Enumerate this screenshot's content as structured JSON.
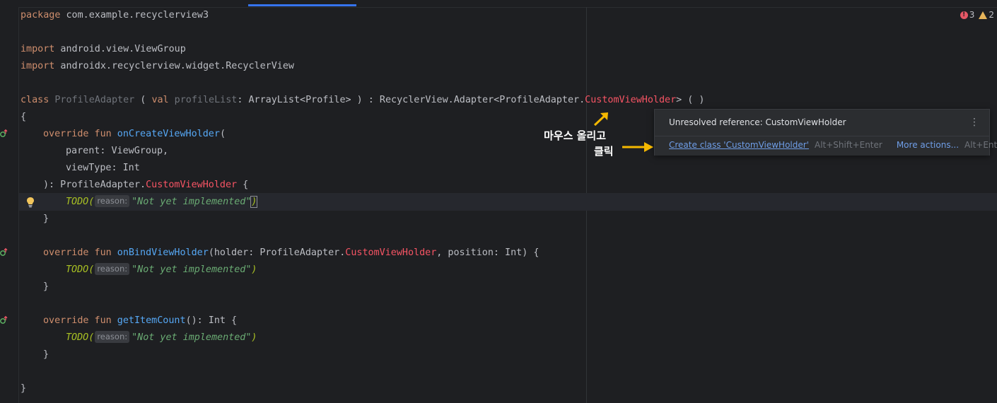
{
  "editor": {
    "line1": {
      "kw": "package",
      "rest": " com.example.recyclerview3"
    },
    "line2": {
      "kw": "import",
      "rest": " android.view.ViewGroup"
    },
    "line3": {
      "kw": "import",
      "rest": " androidx.recyclerview.widget.RecyclerView"
    },
    "line4": {
      "kw1": "class",
      "cls": " ProfileAdapter",
      "p1": " ( ",
      "kw2": "val",
      "param": " profileList",
      "p2": ": ArrayList<Profile> ) : RecyclerView.Adapter<ProfileAdapter.",
      "err": "CustomViewHolder",
      "p3": "> ( )"
    },
    "line5": "{",
    "line6": {
      "kw": "override fun",
      "fn": " onCreateViewHolder",
      "rest": "("
    },
    "line7": "parent: ViewGroup,",
    "line8": "viewType: Int",
    "line9": {
      "a": "): ProfileAdapter.",
      "err": "CustomViewHolder",
      "b": " {"
    },
    "line10": {
      "todo": "TODO(",
      "hint": "reason:",
      "str": "\"Not yet implemented\"",
      "close": ")"
    },
    "line11": "}",
    "line12": {
      "kw": "override fun",
      "fn": " onBindViewHolder",
      "a": "(holder: ProfileAdapter.",
      "err": "CustomViewHolder",
      "b": ", position: Int) {"
    },
    "line13": {
      "todo": "TODO(",
      "hint": "reason:",
      "str": "\"Not yet implemented\"",
      "close": ")"
    },
    "line14": "}",
    "line15": {
      "kw": "override fun",
      "fn": " getItemCount",
      "rest": "(): Int {"
    },
    "line16": {
      "todo": "TODO(",
      "hint": "reason:",
      "str": "\"Not yet implemented\"",
      "close": ")"
    },
    "line17": "}",
    "line18": "}"
  },
  "indicators": {
    "errors": "3",
    "warnings": "2"
  },
  "popup": {
    "title": "Unresolved reference: CustomViewHolder",
    "menu": "⋮",
    "action": "Create class 'CustomViewHolder'",
    "action_shortcut": "Alt+Shift+Enter",
    "more": "More actions...",
    "more_shortcut": "Alt+Enter"
  },
  "annotations": {
    "hover": "마우스 올리고",
    "click": "클릭"
  },
  "icons": [
    "override-marker-icon",
    "lightbulb-icon",
    "error-icon",
    "warning-icon",
    "kebab-menu-icon",
    "arrow-icon"
  ],
  "colors": {
    "background": "#1e1f22",
    "keyword": "#cf8e6d",
    "function": "#56a8f5",
    "error": "#f75464",
    "string": "#6aab73",
    "todo": "#a8c023",
    "arrow": "#f5b800"
  }
}
